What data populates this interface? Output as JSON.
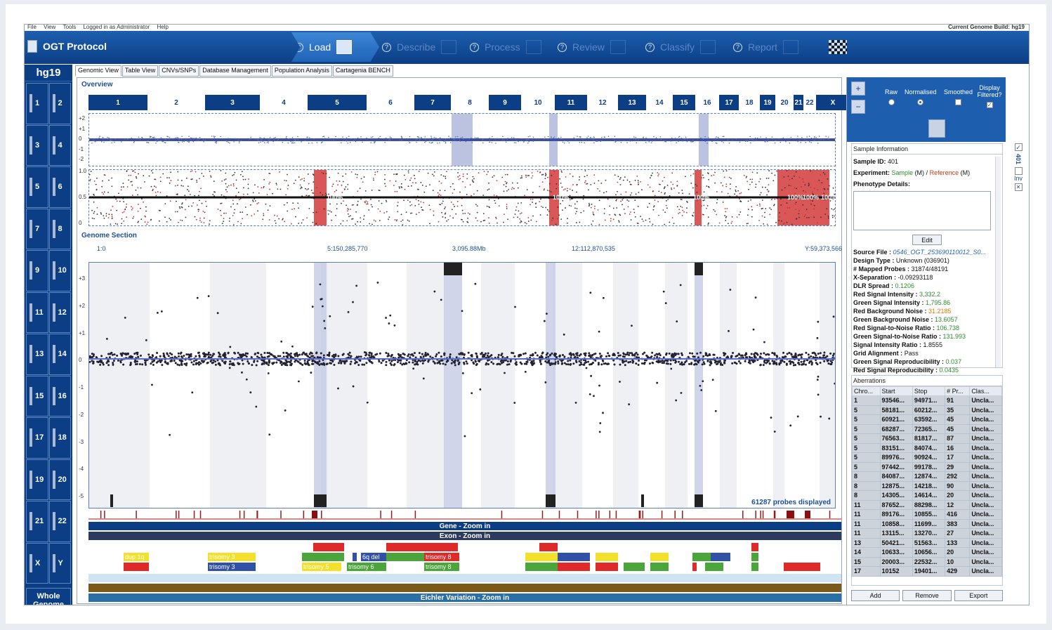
{
  "menu": {
    "items": [
      "File",
      "View",
      "Tools",
      "Logged in as Administrator",
      "Help"
    ],
    "build_label": "Current Genome Build: hg19"
  },
  "app": {
    "title": "OGT Protocol"
  },
  "workflow": {
    "steps": [
      "Load",
      "Describe",
      "Process",
      "Review",
      "Classify",
      "Report"
    ]
  },
  "left": {
    "build": "hg19",
    "chromosomes": [
      "1",
      "2",
      "3",
      "4",
      "5",
      "6",
      "7",
      "8",
      "9",
      "10",
      "11",
      "12",
      "13",
      "14",
      "15",
      "16",
      "17",
      "18",
      "19",
      "20",
      "21",
      "22",
      "X",
      "Y"
    ],
    "whole_genome": "Whole Genome"
  },
  "tabs": [
    "Genomic View",
    "Table View",
    "CNVs/SNPs",
    "Database Management",
    "Population Analysis",
    "Cartagenia BENCH"
  ],
  "overview": {
    "title": "Overview",
    "chromosomes": [
      "1",
      "2",
      "3",
      "4",
      "5",
      "6",
      "7",
      "8",
      "9",
      "10",
      "11",
      "12",
      "13",
      "14",
      "15",
      "16",
      "17",
      "18",
      "19",
      "20",
      "21",
      "22",
      "X",
      "Y"
    ],
    "y_ticks": [
      "+2",
      "+1",
      "0",
      "-1",
      "-2"
    ],
    "baf_ticks": [
      "1.0",
      "0.5",
      "0"
    ],
    "pct_labels": [
      "100%",
      "100%",
      "100%",
      "100%",
      "100%",
      "100%"
    ]
  },
  "genome_section": {
    "title": "Genome Section",
    "ruler": [
      "1:0",
      "5:150,285,770",
      "3,095.88Mb",
      "12:112,870,535",
      "Y:59,373,566"
    ],
    "y_ticks": [
      "+3",
      "+2",
      "+1",
      "0",
      "-1",
      "-2",
      "-3",
      "-4",
      "-5"
    ],
    "probes_label": "61287 probes displayed"
  },
  "tracks": {
    "gene": "Gene - Zoom in",
    "exon": "Exon - Zoom in",
    "eichler": "Eichler Variation - Zoom in"
  },
  "aberration_labels": {
    "dup1q": "dup 1q",
    "trisomy3a": "trisomy 3",
    "trisomy3b": "trisomy 3",
    "del6q": "6q del",
    "trisomy8a": "trisomy 8",
    "trisomy5": "trisomy 5",
    "trisomy6": "trisomy 6",
    "trisomy8b": "trisomy 8"
  },
  "display": {
    "raw": "Raw",
    "normalised": "Normalised",
    "smoothed": "Smoothed",
    "filtered": "Display Filtered?"
  },
  "sample": {
    "title": "Sample Information",
    "id_label": "Sample ID:",
    "id_value": "401",
    "exp_label": "Experiment:",
    "exp_sample": "Sample",
    "exp_m1": "(M)",
    "exp_sep": "/",
    "exp_ref": "Reference",
    "exp_m2": "(M)",
    "pheno_label": "Phenotype Details:",
    "edit": "Edit",
    "source_label": "Source File :",
    "source_value": "0546_OGT_253690110012_S0...",
    "design_label": "Design Type :",
    "design_value": "Unknown (036901)",
    "mapped_label": "# Mapped Probes :",
    "mapped_value": "31874/48191",
    "xsep_label": "X-Separation :",
    "xsep_value": "-0.09293118",
    "dlr_label": "DLR Spread :",
    "dlr_value": "0.1206",
    "rsi_label": "Red Signal Intensity :",
    "rsi_value": "3,332.2",
    "gsi_label": "Green Signal Intensity :",
    "gsi_value": "1,795.86",
    "rbn_label": "Red Background Noise :",
    "rbn_value": "31.2185",
    "gbn_label": "Green Background Noise :",
    "gbn_value": "13.6057",
    "rsn_label": "Red Signal-to-Noise Ratio :",
    "rsn_value": "106.738",
    "gsn_label": "Green Signal-to-Noise Ratio :",
    "gsn_value": "131.993",
    "sir_label": "Signal Intensity Ratio :",
    "sir_value": "1.8555",
    "grid_label": "Grid Alignment :",
    "grid_value": "Pass",
    "gsr_label": "Green Signal Reproducibility :",
    "gsr_value": "0.037",
    "rsr_label": "Red Signal Reproducibility :",
    "rsr_value": "0.0435"
  },
  "side": {
    "sample_num": "401",
    "inv": "Inv"
  },
  "aberrations": {
    "title": "Aberrations",
    "columns": [
      "Chro...",
      "Start",
      "Stop",
      "# Pr...",
      "Clas..."
    ],
    "rows": [
      [
        "1",
        "93546...",
        "94971...",
        "91",
        "Uncla..."
      ],
      [
        "5",
        "58181...",
        "60212...",
        "35",
        "Uncla..."
      ],
      [
        "5",
        "60921...",
        "63592...",
        "45",
        "Uncla..."
      ],
      [
        "5",
        "68287...",
        "72365...",
        "45",
        "Uncla..."
      ],
      [
        "5",
        "76563...",
        "81817...",
        "87",
        "Uncla..."
      ],
      [
        "5",
        "83151...",
        "84074...",
        "16",
        "Uncla..."
      ],
      [
        "5",
        "89976...",
        "90924...",
        "17",
        "Uncla..."
      ],
      [
        "5",
        "97442...",
        "99178...",
        "29",
        "Uncla..."
      ],
      [
        "8",
        "84087...",
        "12874...",
        "292",
        "Uncla..."
      ],
      [
        "8",
        "12875...",
        "14218...",
        "90",
        "Uncla..."
      ],
      [
        "8",
        "14305...",
        "14614...",
        "20",
        "Uncla..."
      ],
      [
        "11",
        "87652...",
        "88298...",
        "12",
        "Uncla..."
      ],
      [
        "11",
        "89176...",
        "10855...",
        "416",
        "Uncla..."
      ],
      [
        "11",
        "10858...",
        "11699...",
        "383",
        "Uncla..."
      ],
      [
        "11",
        "13115...",
        "13270...",
        "27",
        "Uncla..."
      ],
      [
        "13",
        "50421...",
        "51563...",
        "133",
        "Uncla..."
      ],
      [
        "14",
        "10633...",
        "10656...",
        "20",
        "Uncla..."
      ],
      [
        "15",
        "20003...",
        "22532...",
        "10",
        "Uncla..."
      ],
      [
        "17",
        "10152",
        "19401...",
        "429",
        "Uncla..."
      ]
    ],
    "buttons": [
      "Add",
      "Remove",
      "Export"
    ]
  },
  "colors": {
    "navy": "#0c3e86",
    "highlight_red": "#d23a3a",
    "purple_band": "#bcc3e0"
  }
}
